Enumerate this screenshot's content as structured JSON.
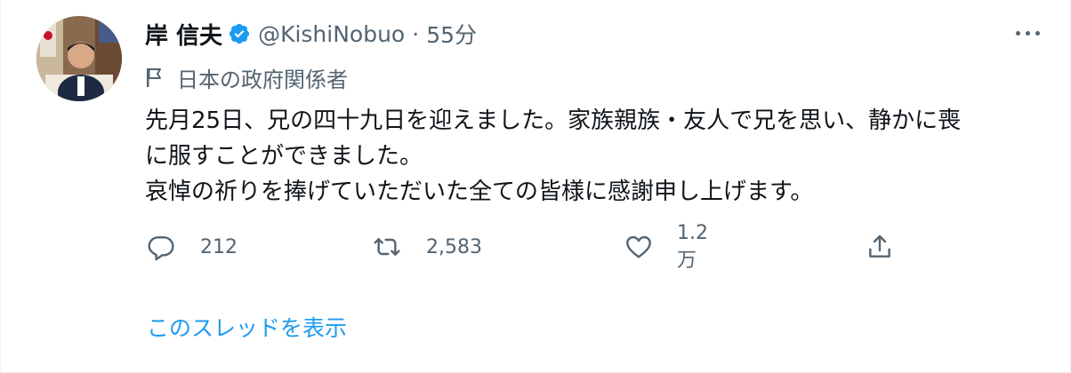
{
  "author": {
    "name": "岸 信夫",
    "handle": "@KishiNobuo",
    "separator": "·",
    "time": "55分",
    "verified": true,
    "label": "日本の政府関係者",
    "avatar": "avatar-photo",
    "label_icon": "flag-icon"
  },
  "tweet": {
    "lines": [
      "先月25日、兄の四十九日を迎えました。家族親族・友人で兄を思い、静かに喪",
      "に服すことができました。",
      "哀悼の祈りを捧げていただいた全ての皆様に感謝申し上げます。"
    ]
  },
  "actions": {
    "reply": {
      "icon": "reply-icon",
      "count": "212"
    },
    "retweet": {
      "icon": "retweet-icon",
      "count": "2,583"
    },
    "like": {
      "icon": "heart-icon",
      "count": "1.2万"
    },
    "share": {
      "icon": "share-icon"
    }
  },
  "thread_link": "このスレッドを表示",
  "colors": {
    "text": "#0f1419",
    "muted": "#536471",
    "accent": "#1d9bf0"
  }
}
